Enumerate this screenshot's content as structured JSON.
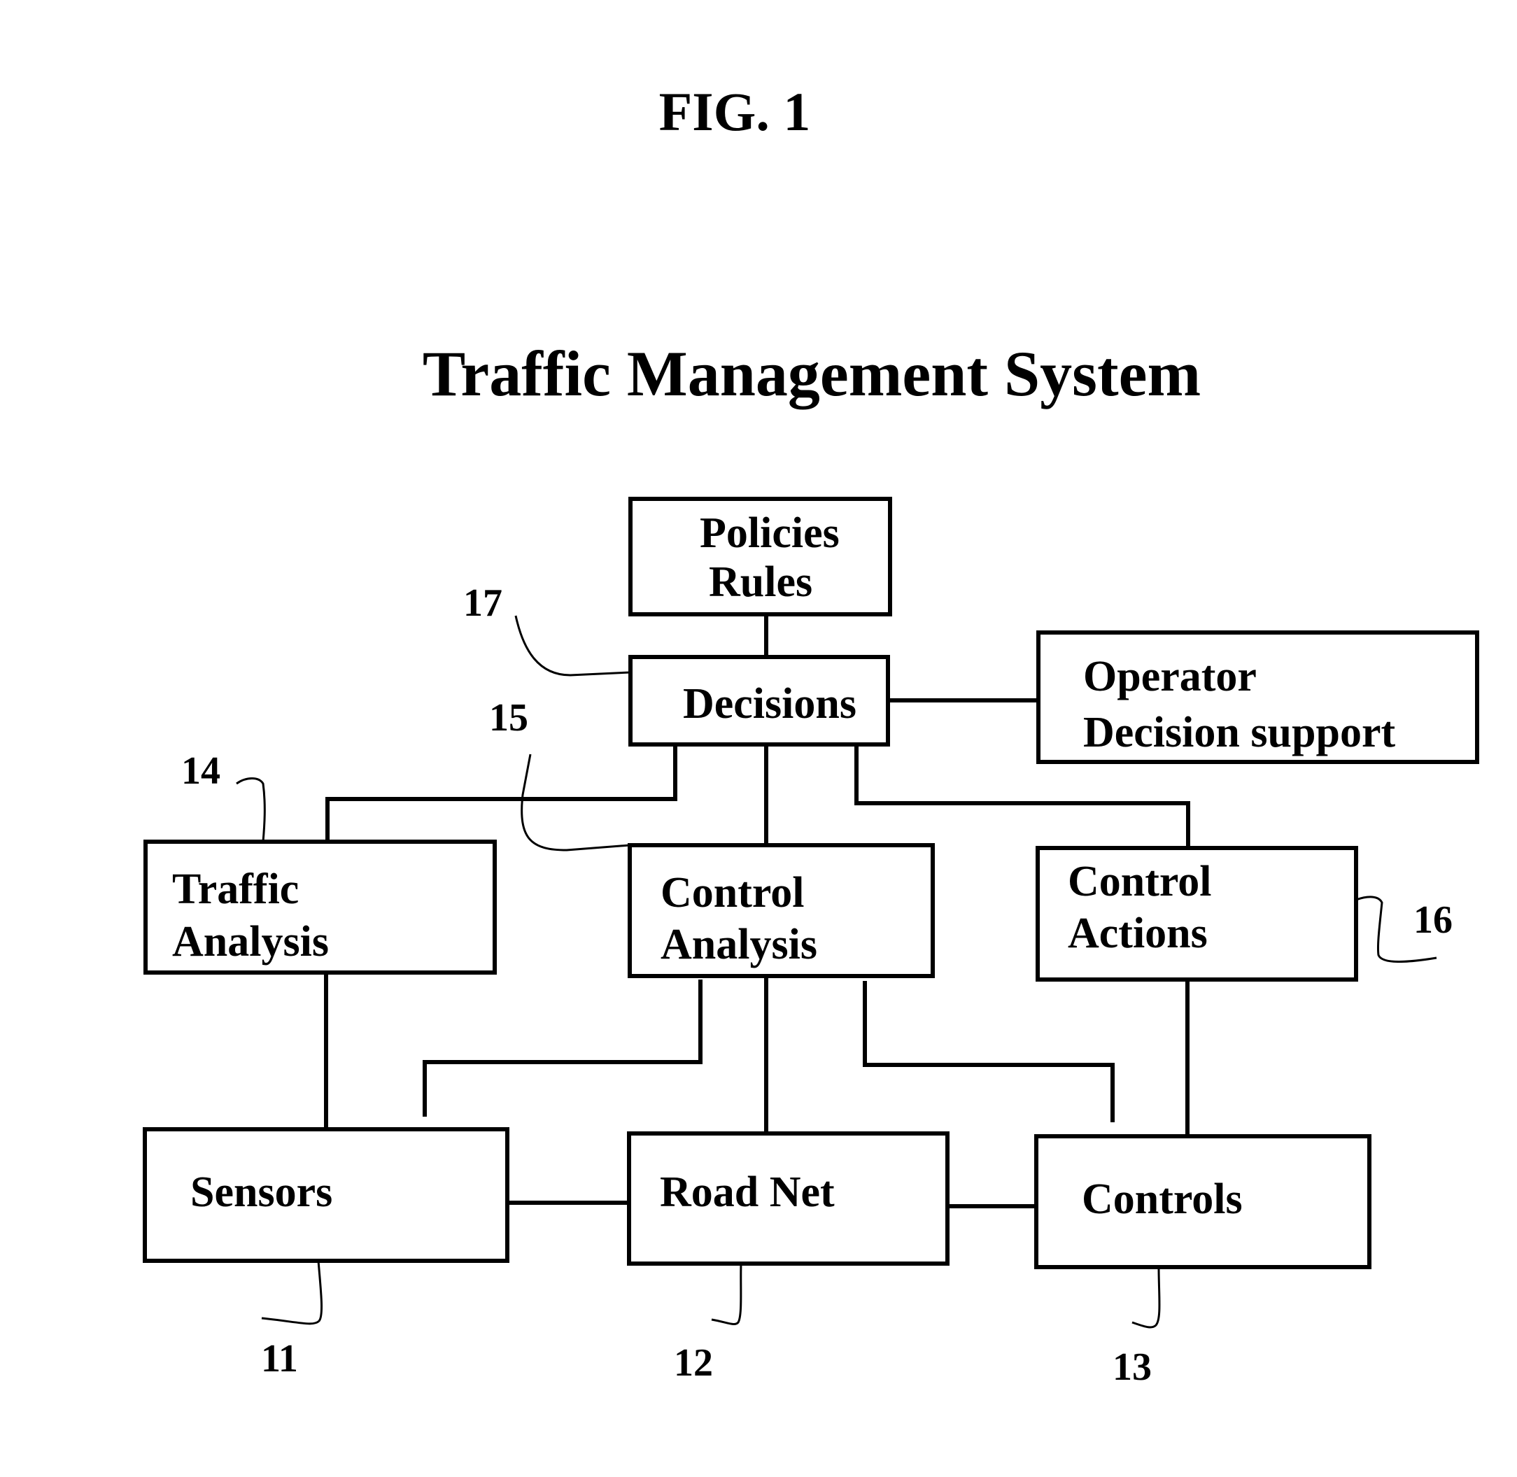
{
  "figure_label": "FIG. 1",
  "title": "Traffic Management System",
  "colors": {
    "ink": "#000000",
    "background": "#ffffff"
  },
  "boxes": {
    "policies": {
      "lines": [
        "Policies",
        "Rules"
      ]
    },
    "decisions": {
      "lines": [
        "Decisions"
      ],
      "ref": "17"
    },
    "operator": {
      "lines": [
        "Operator",
        "Decision support"
      ]
    },
    "traffic_analysis": {
      "lines": [
        "Traffic",
        "Analysis"
      ],
      "ref": "14"
    },
    "control_analysis": {
      "lines": [
        "Control",
        "Analysis"
      ],
      "ref": "15"
    },
    "control_actions": {
      "lines": [
        "Control",
        "Actions"
      ],
      "ref": "16"
    },
    "sensors": {
      "lines": [
        "Sensors"
      ],
      "ref": "11"
    },
    "road_net": {
      "lines": [
        "Road Net"
      ],
      "ref": "12"
    },
    "controls": {
      "lines": [
        "Controls"
      ],
      "ref": "13"
    }
  },
  "connections": [
    [
      "policies",
      "decisions"
    ],
    [
      "decisions",
      "operator"
    ],
    [
      "decisions",
      "traffic_analysis"
    ],
    [
      "decisions",
      "control_analysis"
    ],
    [
      "decisions",
      "control_actions"
    ],
    [
      "traffic_analysis",
      "sensors"
    ],
    [
      "control_analysis",
      "sensors"
    ],
    [
      "control_analysis",
      "road_net"
    ],
    [
      "control_analysis",
      "controls"
    ],
    [
      "control_actions",
      "controls"
    ],
    [
      "sensors",
      "road_net"
    ],
    [
      "road_net",
      "controls"
    ]
  ]
}
